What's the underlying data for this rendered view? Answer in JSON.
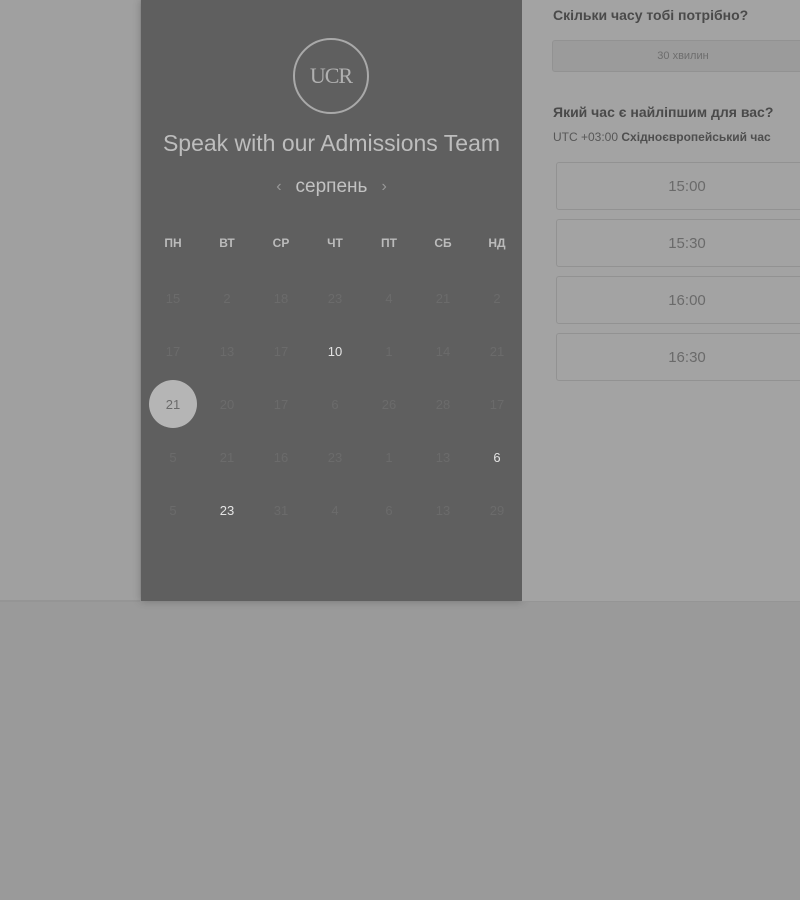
{
  "booking_panel": {
    "logo_text": "UCR",
    "title": "Speak with our Admissions Team",
    "month": "серпень",
    "prev_icon": "chevron-left-icon",
    "next_icon": "chevron-right-icon",
    "weekdays": [
      "ПН",
      "ВТ",
      "СР",
      "ЧТ",
      "ПТ",
      "СБ",
      "НД"
    ],
    "weeks": [
      [
        15,
        2,
        18,
        23,
        4,
        21,
        2
      ],
      [
        17,
        13,
        17,
        10,
        1,
        14,
        21
      ],
      [
        21,
        20,
        17,
        6,
        26,
        28,
        17
      ],
      [
        5,
        21,
        16,
        23,
        1,
        13,
        6
      ],
      [
        5,
        23,
        31,
        4,
        6,
        13,
        29
      ]
    ],
    "enabled_cells": [
      [
        1,
        3
      ],
      [
        2,
        0
      ],
      [
        3,
        6
      ],
      [
        4,
        1
      ]
    ],
    "selected_cell": [
      2,
      0
    ]
  },
  "schedule": {
    "duration_question": "Скільки часу тобі потрібно?",
    "duration_value": "30 хвилин",
    "time_question": "Який час є найліпшим для вас?",
    "timezone_offset": "UTC +03:00",
    "timezone_name": "Східноєвропейський час",
    "slots": [
      "15:00",
      "15:30",
      "16:00",
      "16:30"
    ]
  }
}
